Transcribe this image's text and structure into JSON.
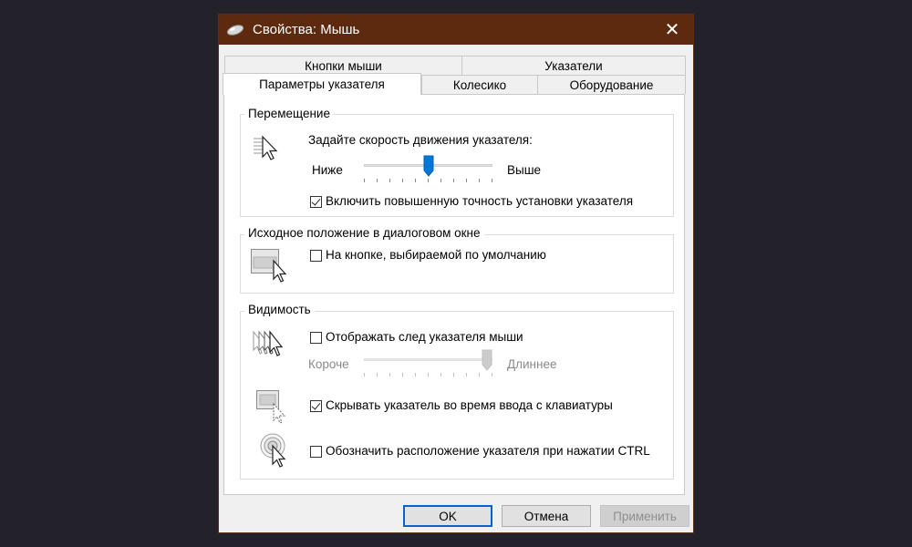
{
  "window": {
    "title": "Свойства: Мышь",
    "close_glyph": "✕"
  },
  "tabs": {
    "row1": [
      "Кнопки мыши",
      "Указатели"
    ],
    "row2": [
      "Параметры указателя",
      "Колесико",
      "Оборудование"
    ],
    "active": "Параметры указателя"
  },
  "motion": {
    "title": "Перемещение",
    "prompt": "Задайте скорость движения указателя:",
    "slow_label": "Ниже",
    "fast_label": "Выше",
    "speed_level": 0.5,
    "precision_label": "Включить повышенную точность установки указателя",
    "precision_checked": true
  },
  "snap": {
    "title": "Исходное положение в диалоговом окне",
    "label": "На кнопке, выбираемой по умолчанию",
    "checked": false
  },
  "visibility": {
    "title": "Видимость",
    "trails_label": "Отображать след указателя мыши",
    "trails_checked": false,
    "short_label": "Короче",
    "long_label": "Длиннее",
    "trail_level": 1.0,
    "hide_label": "Скрывать указатель во время ввода с клавиатуры",
    "hide_checked": true,
    "ctrl_label": "Обозначить расположение указателя при нажатии CTRL",
    "ctrl_checked": false
  },
  "buttons": {
    "ok": "OK",
    "cancel": "Отмена",
    "apply": "Применить"
  },
  "colors": {
    "titlebar": "#5e2a0f",
    "accent": "#0078d7"
  },
  "icons": [
    "mouse-icon",
    "close-icon",
    "pointer-speed-icon",
    "snap-to-icon",
    "pointer-trails-icon",
    "hide-pointer-icon",
    "ctrl-locate-icon"
  ]
}
